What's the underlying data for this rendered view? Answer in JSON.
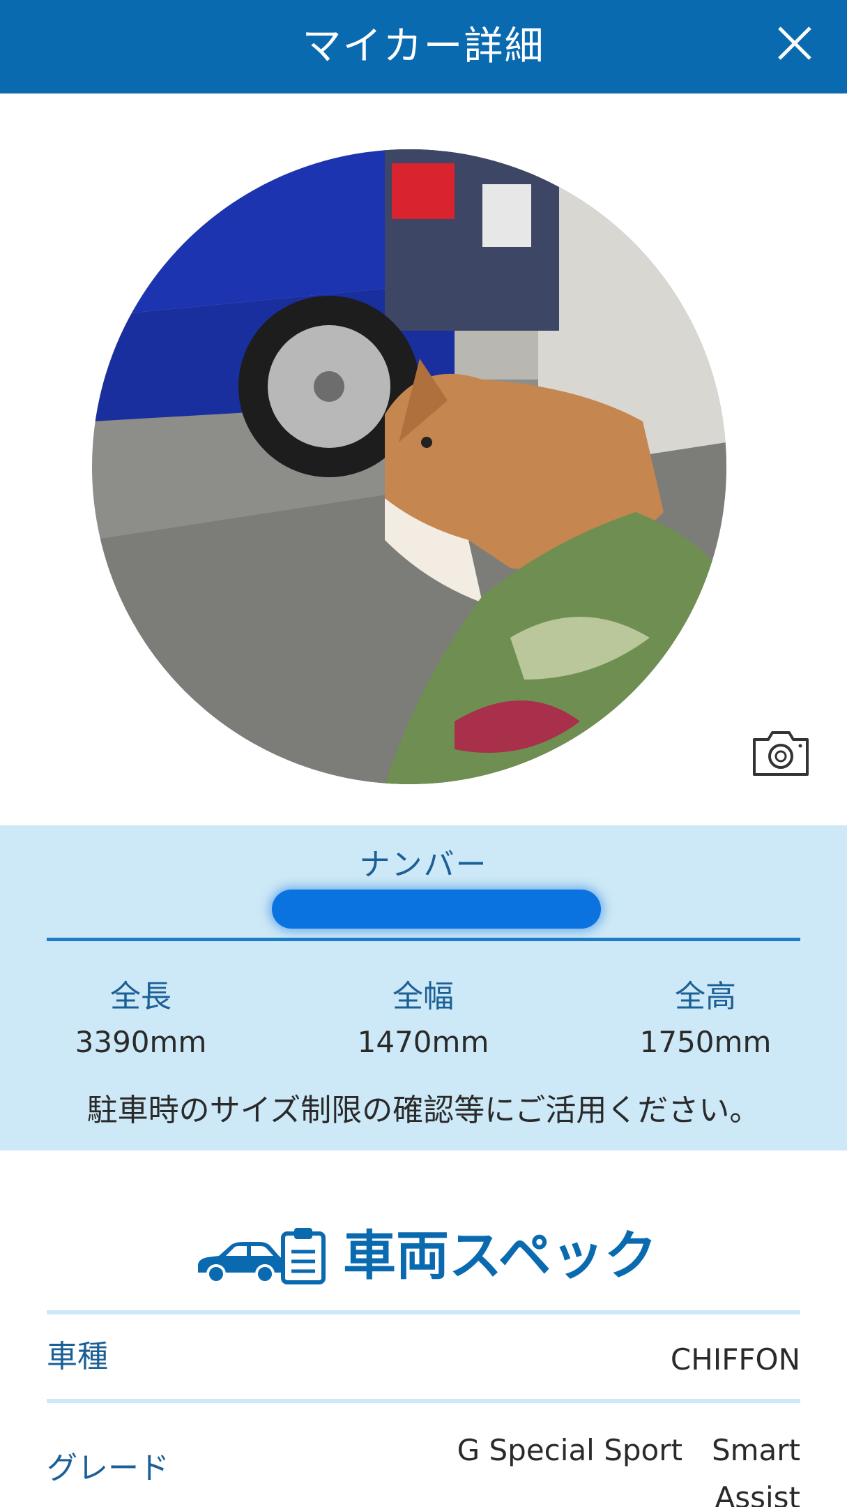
{
  "header": {
    "title": "マイカー詳細",
    "close_icon": "close-icon"
  },
  "photo": {
    "subject": "vehicle-photo",
    "camera_icon": "camera-icon"
  },
  "plate": {
    "label": "ナンバー"
  },
  "dimensions": {
    "length": {
      "label": "全長",
      "value": "3390mm"
    },
    "width": {
      "label": "全幅",
      "value": "1470mm"
    },
    "height": {
      "label": "全高",
      "value": "1750mm"
    },
    "note": "駐車時のサイズ制限の確認等にご活用ください。"
  },
  "specs": {
    "title": "車両スペック",
    "rows": [
      {
        "label": "車種",
        "value": "CHIFFON"
      },
      {
        "label": "グレード",
        "value": "G Special Sport　Smart Assist"
      }
    ]
  },
  "colors": {
    "header": "#0a6ab0",
    "panel": "#cde8f6",
    "accent": "#1d7cc8"
  }
}
